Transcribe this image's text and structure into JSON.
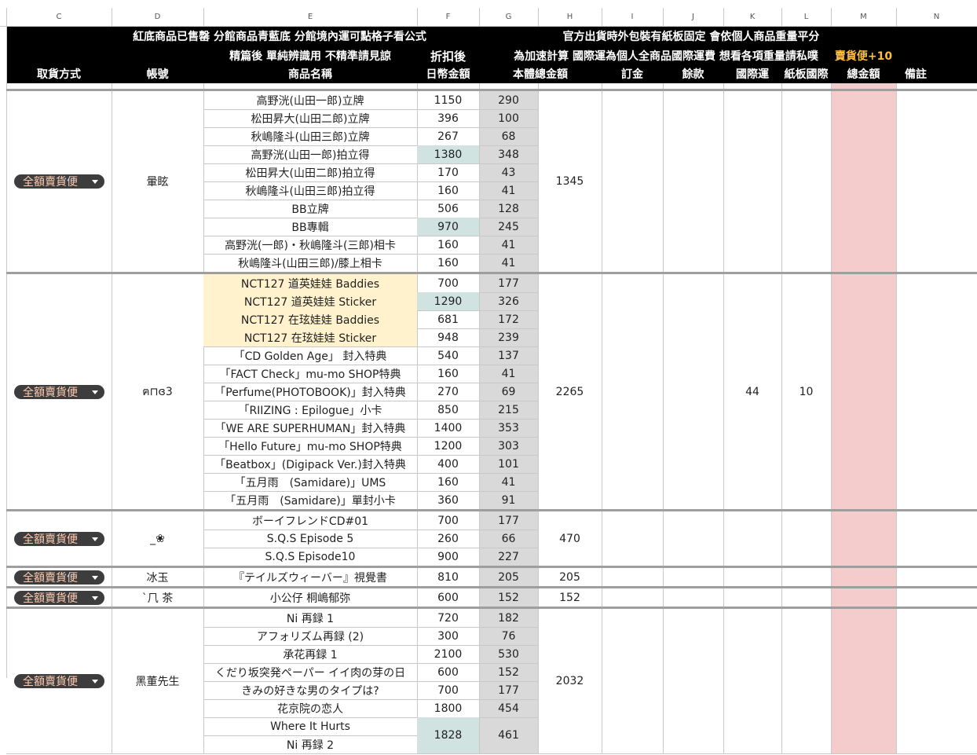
{
  "colors": {
    "header_bg": "#000000",
    "header_text": "#ffffff",
    "header_accent": "#ffbe3c",
    "total_col_bg": "#f4cccc",
    "base_col_bg": "#d9d9d9",
    "highlight_teal": "#d0e3e0",
    "highlight_yellow": "#fff2cc",
    "dropdown_bg": "#3d3d3d",
    "dropdown_text": "#ffccb0"
  },
  "columns": [
    "C",
    "D",
    "E",
    "F",
    "G",
    "H",
    "I",
    "J",
    "K",
    "L",
    "M",
    "N"
  ],
  "header": {
    "row1": {
      "e": "紅底商品已售罄  分館商品青藍底 分館境內運可點格子看公式",
      "g": "官方出貨時外包裝有紙板固定 會依個人商品重量平分"
    },
    "row2": {
      "e": "精篇後 單純辨識用 不精準請見諒",
      "f": "折扣後",
      "g": "為加速計算 國際運為個人全商品國際運費 想看各項重量請私噗",
      "m": "賣貨便+10"
    },
    "row3": {
      "c": "取貨方式",
      "d": "帳號",
      "e": "商品名稱",
      "f": "日幣金額",
      "g": "本體總金額",
      "i": "訂金",
      "j": "餘款",
      "k": "國際運",
      "l": "紙板國際",
      "m": "總金額",
      "n": "備註"
    }
  },
  "groups": [
    {
      "pickup": "全額賣貨便",
      "account": "暈眩",
      "total": "1345",
      "intl": "",
      "board": "",
      "items": [
        {
          "name": "高野洸(山田一郎)立牌",
          "jpy": "1150",
          "base": "290",
          "hl": ""
        },
        {
          "name": "松田昇大(山田二郎)立牌",
          "jpy": "396",
          "base": "100",
          "hl": ""
        },
        {
          "name": "秋嶋隆斗(山田三郎)立牌",
          "jpy": "267",
          "base": "68",
          "hl": ""
        },
        {
          "name": "高野洸(山田一郎)拍立得",
          "jpy": "1380",
          "base": "348",
          "hl": "teal"
        },
        {
          "name": "松田昇大(山田二郎)拍立得",
          "jpy": "170",
          "base": "43",
          "hl": ""
        },
        {
          "name": "秋嶋隆斗(山田三郎)拍立得",
          "jpy": "160",
          "base": "41",
          "hl": ""
        },
        {
          "name": "BB立牌",
          "jpy": "506",
          "base": "128",
          "hl": ""
        },
        {
          "name": "BB專輯",
          "jpy": "970",
          "base": "245",
          "hl": "teal"
        },
        {
          "name": "高野洸(一郎)・秋嶋隆斗(三郎)相卡",
          "jpy": "160",
          "base": "41",
          "hl": ""
        },
        {
          "name": "秋嶋隆斗(山田三郎)/膝上相卡",
          "jpy": "160",
          "base": "41",
          "hl": ""
        }
      ]
    },
    {
      "pickup": "全額賣貨便",
      "account": "ฅ⊓ɞ3",
      "total": "2265",
      "intl": "44",
      "board": "10",
      "items": [
        {
          "name": "NCT127 道英娃娃 Baddies",
          "jpy": "700",
          "base": "177",
          "hl": "yellow"
        },
        {
          "name": "NCT127 道英娃娃 Sticker",
          "jpy": "1290",
          "base": "326",
          "hl": "yellow-teal"
        },
        {
          "name": "NCT127 在玹娃娃 Baddies",
          "jpy": "681",
          "base": "172",
          "hl": "yellow"
        },
        {
          "name": "NCT127 在玹娃娃 Sticker",
          "jpy": "948",
          "base": "239",
          "hl": "yellow"
        },
        {
          "name": "「CD Golden Age」 封入特典",
          "jpy": "540",
          "base": "137",
          "hl": ""
        },
        {
          "name": "「FACT Check」mu-mo SHOP特典",
          "jpy": "160",
          "base": "41",
          "hl": ""
        },
        {
          "name": "「Perfume(PHOTOBOOK)」封入特典",
          "jpy": "270",
          "base": "69",
          "hl": ""
        },
        {
          "name": "「RIIZING : Epilogue」小卡",
          "jpy": "850",
          "base": "215",
          "hl": ""
        },
        {
          "name": "「WE ARE SUPERHUMAN」封入特典",
          "jpy": "1400",
          "base": "353",
          "hl": ""
        },
        {
          "name": "「Hello Future」mu-mo SHOP特典",
          "jpy": "1200",
          "base": "303",
          "hl": ""
        },
        {
          "name": "「Beatbox」(Digipack Ver.)封入特典",
          "jpy": "400",
          "base": "101",
          "hl": ""
        },
        {
          "name": "「五月雨　(Samidare)」UMS",
          "jpy": "160",
          "base": "41",
          "hl": ""
        },
        {
          "name": "「五月雨　(Samidare)」單封小卡",
          "jpy": "360",
          "base": "91",
          "hl": ""
        }
      ]
    },
    {
      "pickup": "全額賣貨便",
      "account": "_❀",
      "total": "470",
      "intl": "",
      "board": "",
      "items": [
        {
          "name": "ボーイフレンドCD#01",
          "jpy": "700",
          "base": "177",
          "hl": ""
        },
        {
          "name": "S.Q.S Episode 5",
          "jpy": "260",
          "base": "66",
          "hl": ""
        },
        {
          "name": "S.Q.S Episode10",
          "jpy": "900",
          "base": "227",
          "hl": ""
        }
      ]
    },
    {
      "pickup": "全額賣貨便",
      "account": "冰玉",
      "total": "205",
      "intl": "",
      "board": "",
      "items": [
        {
          "name": "『テイルズウィーバー』視覺書",
          "jpy": "810",
          "base": "205",
          "hl": ""
        }
      ]
    },
    {
      "pickup": "全額賣貨便",
      "account": "ˋ⺇ 茶",
      "total": "152",
      "intl": "",
      "board": "",
      "items": [
        {
          "name": "小公仔 桐嶋郁弥",
          "jpy": "600",
          "base": "152",
          "hl": ""
        }
      ]
    },
    {
      "pickup": "全額賣貨便",
      "account": "黑董先生",
      "total": "2032",
      "intl": "",
      "board": "",
      "items": [
        {
          "name": "Ni 再録 1",
          "jpy": "720",
          "base": "182",
          "hl": ""
        },
        {
          "name": "アフォリズム再録 (2)",
          "jpy": "300",
          "base": "76",
          "hl": ""
        },
        {
          "name": "承花再録 1",
          "jpy": "2100",
          "base": "530",
          "hl": ""
        },
        {
          "name": "くだり坂突発ペーパー イイ肉の芽の日",
          "jpy": "600",
          "base": "152",
          "hl": ""
        },
        {
          "name": "きみの好きな男のタイプは?",
          "jpy": "700",
          "base": "177",
          "hl": ""
        },
        {
          "name": "花京院の恋人",
          "jpy": "1800",
          "base": "454",
          "hl": ""
        },
        {
          "name": "Where It Hurts",
          "jpy": "1828",
          "base": "461",
          "hl": "teal",
          "merge_next": true
        },
        {
          "name": "Ni 再録 2",
          "jpy": "",
          "base": "",
          "hl": "",
          "merged": true
        }
      ]
    }
  ]
}
